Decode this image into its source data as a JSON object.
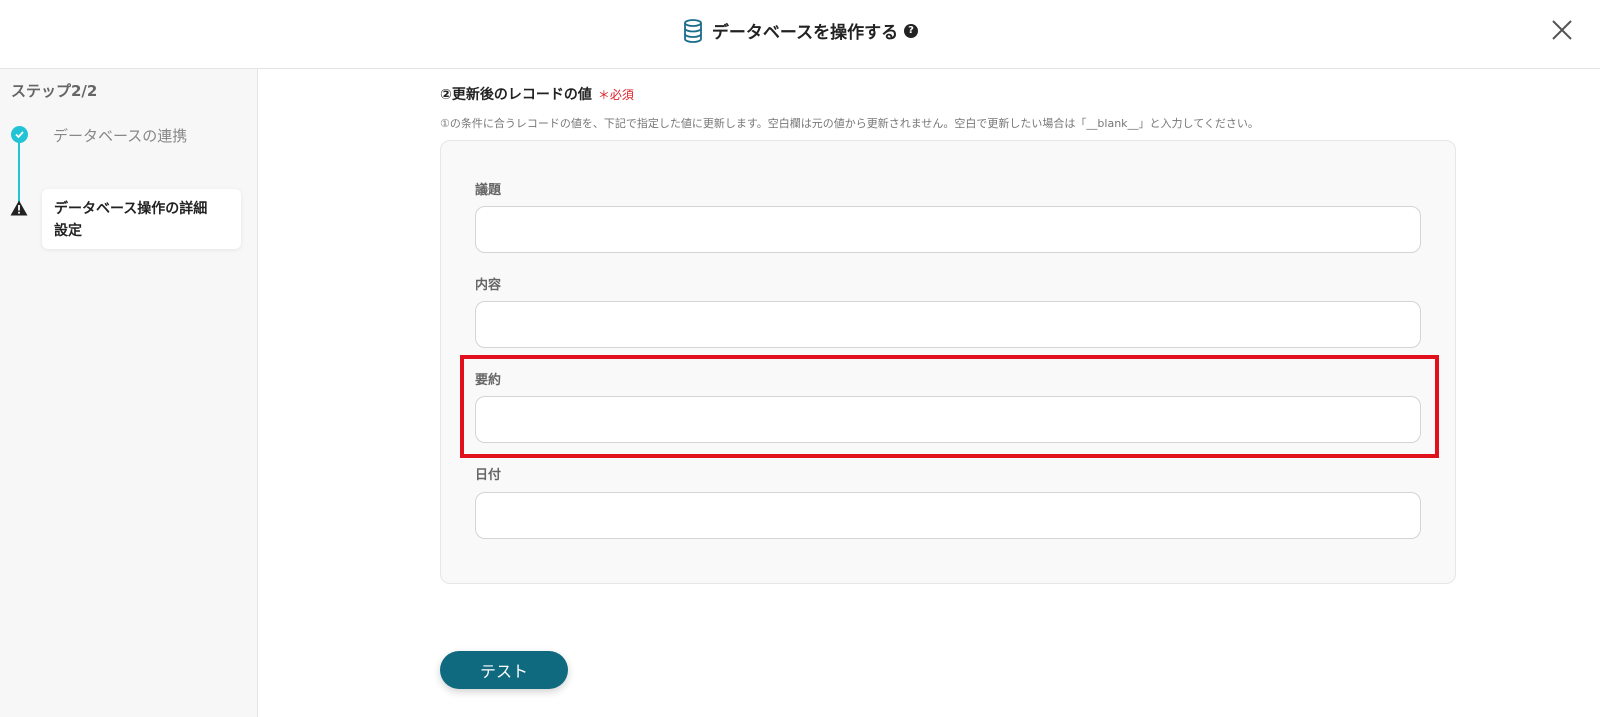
{
  "header": {
    "title": "データベースを操作する",
    "help_icon": "?",
    "db_icon": "database-icon",
    "close_icon": "close-icon"
  },
  "sidebar": {
    "step_label": "ステップ2/2",
    "steps": [
      {
        "label": "データベースの連携",
        "status": "done"
      },
      {
        "label_line1": "データベース操作の詳細",
        "label_line2": "設定",
        "status": "warning"
      }
    ]
  },
  "section": {
    "title": "②更新後のレコードの値",
    "required": "＊必須",
    "description": "①の条件に合うレコードの値を、下記で指定した値に更新します。空白欄は元の値から更新されません。空白で更新したい場合は「__blank__」と入力してください。"
  },
  "fields": [
    {
      "label": "議題",
      "value": ""
    },
    {
      "label": "内容",
      "value": ""
    },
    {
      "label": "要約",
      "value": ""
    },
    {
      "label": "日付",
      "value": ""
    }
  ],
  "buttons": {
    "test": "テスト"
  },
  "colors": {
    "accent": "#22c3d4",
    "button": "#0f6a80",
    "required": "#e0202a",
    "highlight": "#e0101c"
  }
}
